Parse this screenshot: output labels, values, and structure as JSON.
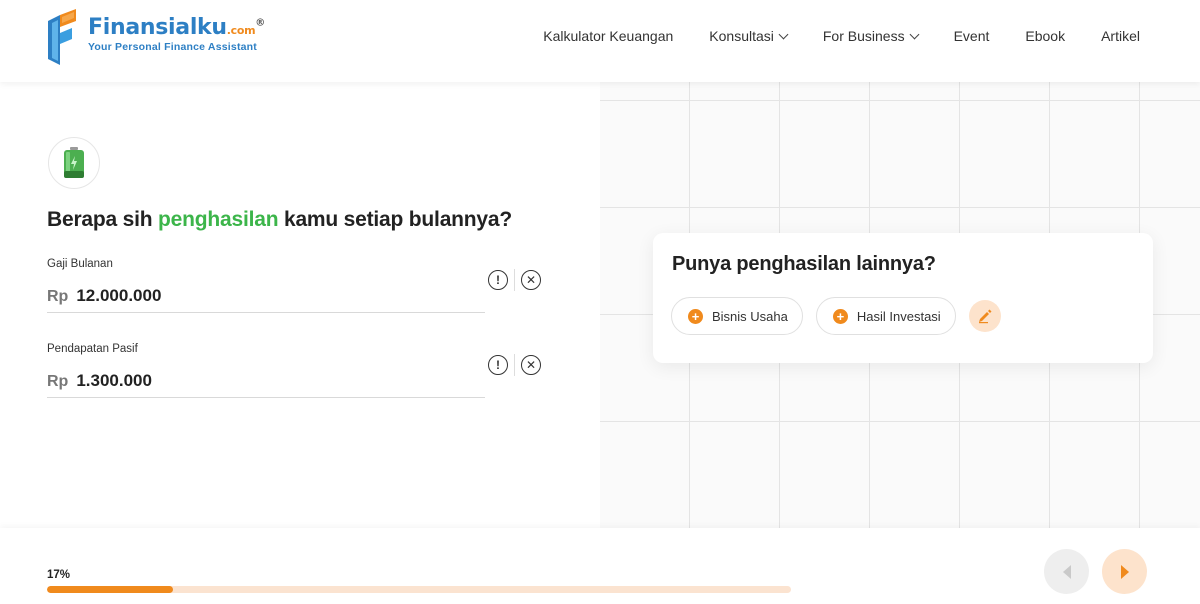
{
  "header": {
    "logo_brand": "Finansialku",
    "logo_suffix": ".com",
    "logo_reg": "®",
    "logo_tagline": "Your Personal Finance Assistant",
    "nav": [
      {
        "label": "Kalkulator Keuangan",
        "dropdown": false
      },
      {
        "label": "Konsultasi",
        "dropdown": true
      },
      {
        "label": "For Business",
        "dropdown": true
      },
      {
        "label": "Event",
        "dropdown": false
      },
      {
        "label": "Ebook",
        "dropdown": false
      },
      {
        "label": "Artikel",
        "dropdown": false
      }
    ]
  },
  "main": {
    "icon": "battery-icon",
    "question_pre": "Berapa sih ",
    "question_highlight": "penghasilan",
    "question_post": " kamu setiap bulannya?",
    "fields": [
      {
        "label": "Gaji Bulanan",
        "currency": "Rp",
        "value": "12.000.000"
      },
      {
        "label": "Pendapatan Pasif",
        "currency": "Rp",
        "value": "1.300.000"
      }
    ]
  },
  "side_card": {
    "title": "Punya penghasilan lainnya?",
    "chips": [
      {
        "label": "Bisnis Usaha"
      },
      {
        "label": "Hasil Investasi"
      }
    ]
  },
  "footer": {
    "progress_label": "17%",
    "progress_value": 0.17
  },
  "colors": {
    "accent": "#f08a1d",
    "brand_blue": "#2d7fc4",
    "highlight_green": "#3cb54a"
  }
}
